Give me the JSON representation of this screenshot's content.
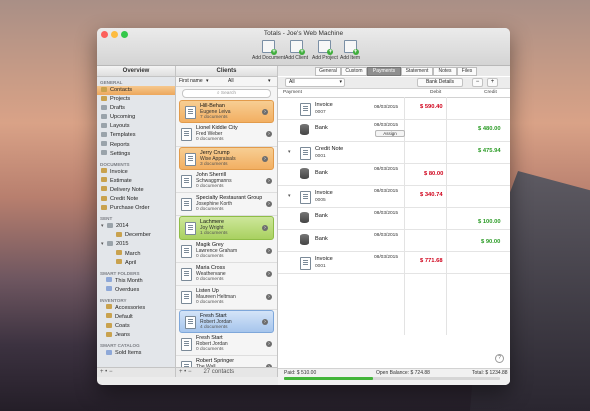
{
  "window": {
    "title": "Totals - Joe's Web Machine"
  },
  "toolbar": {
    "add_document": "Add Document",
    "add_client": "Add Client",
    "add_project": "Add Project",
    "add_item": "Add Item"
  },
  "sidebar": {
    "header": "Overview",
    "general_label": "GENERAL",
    "general": [
      "Contacts",
      "Projects",
      "Drafts",
      "Upcoming",
      "Layouts",
      "Templates",
      "Reports",
      "Settings"
    ],
    "documents_label": "DOCUMENTS",
    "documents": [
      "Invoice",
      "Estimate",
      "Delivery Note",
      "Credit Note",
      "Purchase Order"
    ],
    "sent_label": "SENT",
    "sent": [
      {
        "label": "2014",
        "children": [
          "December"
        ]
      },
      {
        "label": "2015",
        "children": [
          "March",
          "April"
        ]
      }
    ],
    "smart_folders_label": "SMART FOLDERS",
    "smart_folders": [
      "This Month",
      "Overdues"
    ],
    "inventory_label": "INVENTORY",
    "inventory": [
      "Accessories",
      "Default",
      "Coats",
      "Jeans"
    ],
    "smart_catalog_label": "SMART CATALOG",
    "smart_catalog": [
      "Sold Items"
    ],
    "footer": "+ • −"
  },
  "clients": {
    "header": "Clients",
    "filter_left": "First name",
    "filter_right": "All",
    "search_placeholder": "Search",
    "items": [
      {
        "name": "Hill-Behan",
        "person": "Eugene Leiva",
        "docs": "7 documents"
      },
      {
        "name": "Lionel Kiddie City",
        "person": "Fred Weber",
        "docs": "0 documents"
      },
      {
        "name": "Jerry Crump",
        "person": "Wise Appraisals",
        "docs": "3 documents"
      },
      {
        "name": "John Sherrill",
        "person": "Schwaggmanns",
        "docs": "0 documents"
      },
      {
        "name": "Specialty Restaurant Group",
        "person": "Josephine Korth",
        "docs": "0 documents"
      },
      {
        "name": "Lachmere",
        "person": "Joy Wright",
        "docs": "1 documents"
      },
      {
        "name": "Magik Grey",
        "person": "Lawrence Graham",
        "docs": "0 documents"
      },
      {
        "name": "Maria Cross",
        "person": "Weathervane",
        "docs": "0 documents"
      },
      {
        "name": "Listen Up",
        "person": "Maureen Heltman",
        "docs": "0 documents"
      },
      {
        "name": "Fresh Start",
        "person": "Robert Jordan",
        "docs": "4 documents"
      },
      {
        "name": "Fresh Start",
        "person": "Robert Jordan",
        "docs": "0 documents"
      },
      {
        "name": "Robert Springer",
        "person": "The Wall",
        "docs": ""
      }
    ],
    "footer_count": "27 contacts",
    "footer_controls": "+ • −"
  },
  "tabs": [
    "General",
    "Custom",
    "Payments",
    "Statement",
    "Notes",
    "Files"
  ],
  "active_tab": "Payments",
  "payments": {
    "filter": "All",
    "bank_details": "Bank Details",
    "minus": "−",
    "plus": "+",
    "col_payment": "Payment",
    "col_debit": "Debit",
    "col_credit": "Credit",
    "rows": [
      {
        "type": "Invoice",
        "number": "0007",
        "date": "08/03/2015",
        "debit": "$ 590.40",
        "credit": ""
      },
      {
        "type": "Bank",
        "number": "",
        "date": "08/03/2015",
        "debit": "",
        "credit": "$ 480.00",
        "assign": "Assign"
      },
      {
        "type": "Credit Note",
        "number": "0001",
        "date": "",
        "debit": "",
        "credit": "$ 475.94"
      },
      {
        "type": "Bank",
        "number": "",
        "date": "08/03/2015",
        "debit": "$ 80.00",
        "credit": ""
      },
      {
        "type": "Invoice",
        "number": "0005",
        "date": "08/03/2015",
        "debit": "$ 340.74",
        "credit": ""
      },
      {
        "type": "Bank",
        "number": "",
        "date": "08/03/2015",
        "debit": "",
        "credit": "$ 100.00"
      },
      {
        "type": "Bank",
        "number": "",
        "date": "08/03/2015",
        "debit": "",
        "credit": "$ 90.00"
      },
      {
        "type": "Invoice",
        "number": "0001",
        "date": "08/03/2015",
        "debit": "$ 771.68",
        "credit": ""
      }
    ],
    "paid": "Paid: $ 510.00",
    "open_balance": "Open Balance: $ 724.88",
    "total": "Total: $ 1234.88",
    "paid_fraction": 0.41,
    "help": "?"
  },
  "colors": {
    "debit": "#d0021b",
    "credit": "#2a9b25",
    "selection": "#eda75c"
  }
}
